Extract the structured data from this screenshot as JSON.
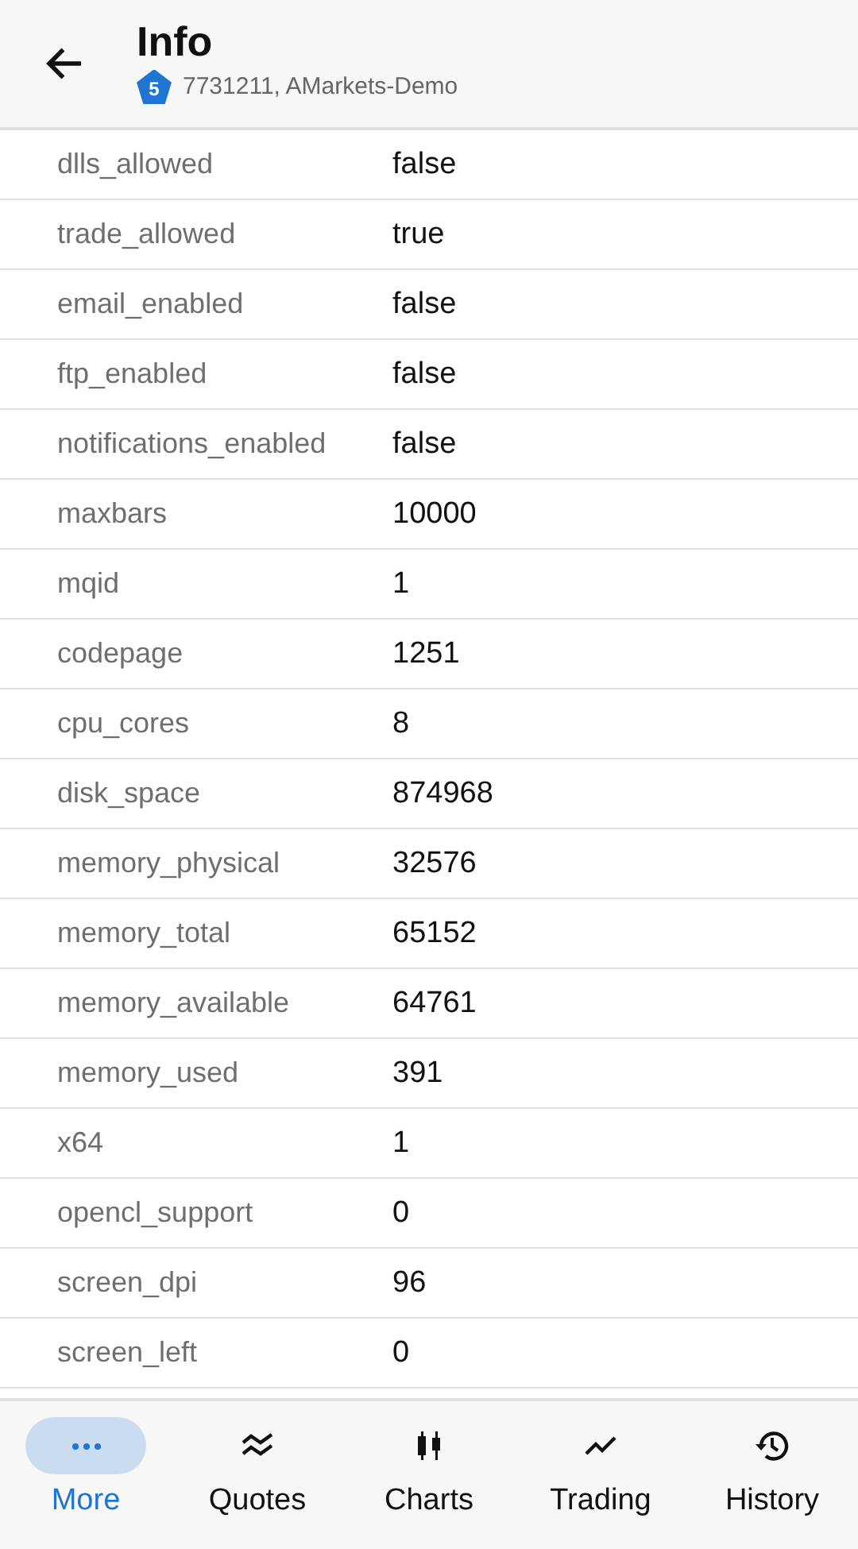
{
  "header": {
    "title": "Info",
    "badge": "5",
    "account": "7731211, AMarkets-Demo"
  },
  "rows": [
    {
      "key": "dlls_allowed",
      "value": "false"
    },
    {
      "key": "trade_allowed",
      "value": "true"
    },
    {
      "key": "email_enabled",
      "value": "false"
    },
    {
      "key": "ftp_enabled",
      "value": "false"
    },
    {
      "key": "notifications_enabled",
      "value": "false"
    },
    {
      "key": "maxbars",
      "value": "10000"
    },
    {
      "key": "mqid",
      "value": "1"
    },
    {
      "key": "codepage",
      "value": "1251"
    },
    {
      "key": "cpu_cores",
      "value": "8"
    },
    {
      "key": "disk_space",
      "value": "874968"
    },
    {
      "key": "memory_physical",
      "value": "32576"
    },
    {
      "key": "memory_total",
      "value": "65152"
    },
    {
      "key": "memory_available",
      "value": "64761"
    },
    {
      "key": "memory_used",
      "value": "391"
    },
    {
      "key": "x64",
      "value": "1"
    },
    {
      "key": "opencl_support",
      "value": "0"
    },
    {
      "key": "screen_dpi",
      "value": "96"
    },
    {
      "key": "screen_left",
      "value": "0"
    }
  ],
  "nav": [
    {
      "kind": "more",
      "label": "More",
      "selected": true
    },
    {
      "kind": "quotes",
      "label": "Quotes",
      "selected": false
    },
    {
      "kind": "charts",
      "label": "Charts",
      "selected": false
    },
    {
      "kind": "trading",
      "label": "Trading",
      "selected": false
    },
    {
      "kind": "history",
      "label": "History",
      "selected": false
    }
  ]
}
